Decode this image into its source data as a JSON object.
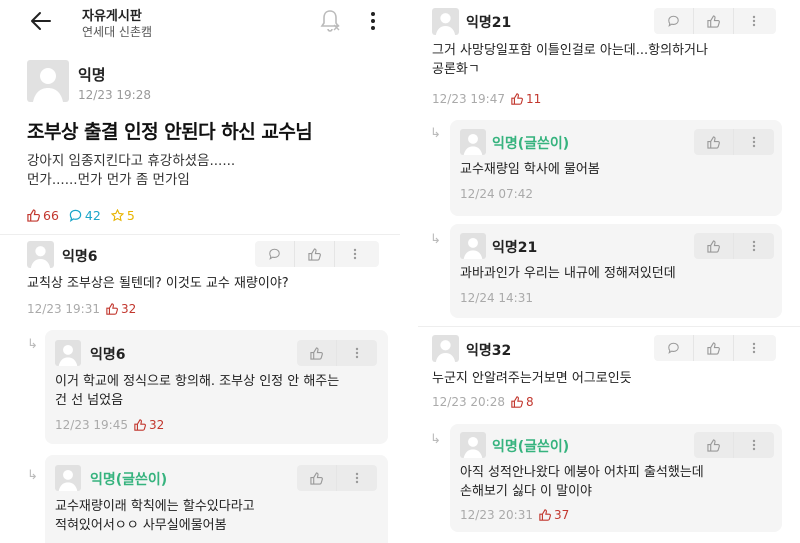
{
  "header": {
    "board_title": "자유게시판",
    "board_subtitle": "연세대 신촌캠"
  },
  "post": {
    "author": "익명",
    "time": "12/23 19:28",
    "title": "조부상 출결 인정 안된다 하신 교수님",
    "body": "강아지 임종지킨다고 휴강하셨음......\n먼가......먼가 먼가 좀 먼가임",
    "likes": "66",
    "comments": "42",
    "scraps": "5"
  },
  "left_comments": [
    {
      "author": "익명6",
      "text": "교칙상 조부상은 될텐데? 이것도 교수 재량이야?",
      "time": "12/23 19:31",
      "likes": "32"
    }
  ],
  "left_replies": [
    {
      "author": "익명6",
      "text": "이거 학교에 정식으로 항의해. 조부상 인정 안 해주는\n건 선 넘었음",
      "time": "12/23 19:45",
      "likes": "32"
    },
    {
      "author": "익명(글쓴이)",
      "text": "교수재량이래 학칙에는 할수있다라고\n적혀있어서ㅇㅇ 사무실에물어봄"
    }
  ],
  "right_comments": [
    {
      "author": "익명21",
      "text": "그거 사망당일포함 이틀인걸로 아는데...항의하거나\n공론화ㄱ",
      "time": "12/23 19:47",
      "likes": "11"
    },
    {
      "author": "익명32",
      "text": "누군지 안알려주는거보면 어그로인듯",
      "time": "12/23 20:28",
      "likes": "8"
    }
  ],
  "right_replies": [
    {
      "author": "익명(글쓴이)",
      "text": "교수재량임 학사에 물어봄",
      "time": "12/24 07:42"
    },
    {
      "author": "익명21",
      "text": "과바과인가 우리는 내규에 정해져있던데",
      "time": "12/24 14:31"
    },
    {
      "author": "익명(글쓴이)",
      "text": "아직 성적안나왔다 에붕아 어차피 출석했는데\n손해보기 싫다 이 말이야",
      "time": "12/23 20:31",
      "likes": "37"
    }
  ],
  "colors": {
    "like": "#c2372e",
    "comment": "#1ca6c9",
    "scrap": "#e8b400",
    "op_name": "#36b37e"
  },
  "icons": [
    "back-arrow-icon",
    "bell-off-icon",
    "more-vert-icon",
    "comment-icon",
    "thumbs-up-icon",
    "reply-arrow-icon",
    "avatar-icon",
    "star-icon"
  ]
}
